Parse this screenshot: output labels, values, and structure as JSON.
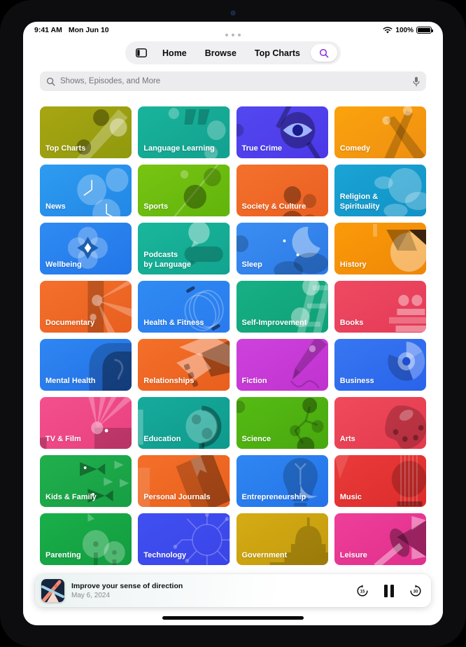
{
  "statusbar": {
    "time": "9:41 AM",
    "date": "Mon Jun 10",
    "battery_percent": "100%",
    "wifi_icon": "wifi-icon",
    "battery_icon": "battery-full-icon"
  },
  "navbar": {
    "sidebar_icon": "sidebar-toggle-icon",
    "items": [
      {
        "label": "Home"
      },
      {
        "label": "Browse"
      },
      {
        "label": "Top Charts"
      }
    ],
    "search_icon": "search-icon",
    "search_active_color": "#8B2BE2"
  },
  "search": {
    "placeholder": "Shows, Episodes, and More",
    "search_icon": "search-icon",
    "mic_icon": "microphone-icon"
  },
  "categories": [
    {
      "label": "Top Charts",
      "c1": "#a8a512",
      "c2": "#8f9a0d",
      "art": "topcharts"
    },
    {
      "label": "Language Learning",
      "c1": "#18b49b",
      "c2": "#13a08f",
      "art": "quotes"
    },
    {
      "label": "True Crime",
      "c1": "#5348f0",
      "c2": "#4b38e8",
      "art": "eyeglass"
    },
    {
      "label": "Comedy",
      "c1": "#fba30c",
      "c2": "#ef8f12",
      "art": "spotlight"
    },
    {
      "label": "News",
      "c1": "#2e9bf0",
      "c2": "#2288e6",
      "art": "clocks"
    },
    {
      "label": "Sports",
      "c1": "#78c412",
      "c2": "#61b40c",
      "art": "leaf"
    },
    {
      "label": "Society & Culture",
      "c1": "#f4712c",
      "c2": "#ea5f22",
      "art": "people"
    },
    {
      "label": "Religion &\nSpirituality",
      "c1": "#1aa4d4",
      "c2": "#1192c6",
      "art": "clouds"
    },
    {
      "label": "Wellbeing",
      "c1": "#2f8bf2",
      "c2": "#2276e8",
      "art": "flower"
    },
    {
      "label": "Podcasts\nby Language",
      "c1": "#19b79c",
      "c2": "#12a38e",
      "art": "bubbles"
    },
    {
      "label": "Sleep",
      "c1": "#3a8ef2",
      "c2": "#2d7ae6",
      "art": "moon"
    },
    {
      "label": "History",
      "c1": "#fb9b08",
      "c2": "#ee8708",
      "art": "pyramid"
    },
    {
      "label": "Documentary",
      "c1": "#f4702c",
      "c2": "#e85f1f",
      "art": "projector"
    },
    {
      "label": "Health & Fitness",
      "c1": "#2f8bf2",
      "c2": "#2a7bee",
      "art": "rings"
    },
    {
      "label": "Self-Improvement",
      "c1": "#17b084",
      "c2": "#0fa077",
      "art": "ladder"
    },
    {
      "label": "Books",
      "c1": "#ef4a62",
      "c2": "#e43a57",
      "art": "books"
    },
    {
      "label": "Mental Health",
      "c1": "#2e87f2",
      "c2": "#2470e6",
      "art": "head"
    },
    {
      "label": "Relationships",
      "c1": "#f4702a",
      "c2": "#e85f1e",
      "art": "handshake"
    },
    {
      "label": "Fiction",
      "c1": "#ce42dc",
      "c2": "#bf32cf",
      "art": "pen"
    },
    {
      "label": "Business",
      "c1": "#3777f2",
      "c2": "#2a63ea",
      "art": "chart"
    },
    {
      "label": "TV & Film",
      "c1": "#f4508e",
      "c2": "#e8407f",
      "art": "beams"
    },
    {
      "label": "Education",
      "c1": "#17ab9c",
      "c2": "#0e9a8c",
      "art": "globe"
    },
    {
      "label": "Science",
      "c1": "#56bb14",
      "c2": "#47a80e",
      "art": "molecule"
    },
    {
      "label": "Arts",
      "c1": "#f04a5c",
      "c2": "#e43a4e",
      "art": "palette"
    },
    {
      "label": "Kids & Family",
      "c1": "#21b04e",
      "c2": "#169e43",
      "art": "fish"
    },
    {
      "label": "Personal Journals",
      "c1": "#f4702a",
      "c2": "#e8601c",
      "art": "journal"
    },
    {
      "label": "Entrepreneurship",
      "c1": "#2f87f2",
      "c2": "#2473e8",
      "art": "bulb"
    },
    {
      "label": "Music",
      "c1": "#ea3b3b",
      "c2": "#dc2b2b",
      "art": "guitar"
    },
    {
      "label": "Parenting",
      "c1": "#1aaf4a",
      "c2": "#129c3f",
      "art": "trees"
    },
    {
      "label": "Technology",
      "c1": "#4050f0",
      "c2": "#3a44e8",
      "art": "circuit"
    },
    {
      "label": "Government",
      "c1": "#d4ac14",
      "c2": "#c49a0c",
      "art": "capitol"
    },
    {
      "label": "Leisure",
      "c1": "#ee3f9a",
      "c2": "#e02f8c",
      "art": "kite"
    }
  ],
  "miniplayer": {
    "title": "Improve your sense of direction",
    "date": "May 6, 2024",
    "artwork_name": "episode-artwork",
    "skip_back_label": "15",
    "skip_forward_label": "30",
    "skip_back_icon": "skip-back-15-icon",
    "pause_icon": "pause-icon",
    "skip_forward_icon": "skip-forward-30-icon"
  }
}
